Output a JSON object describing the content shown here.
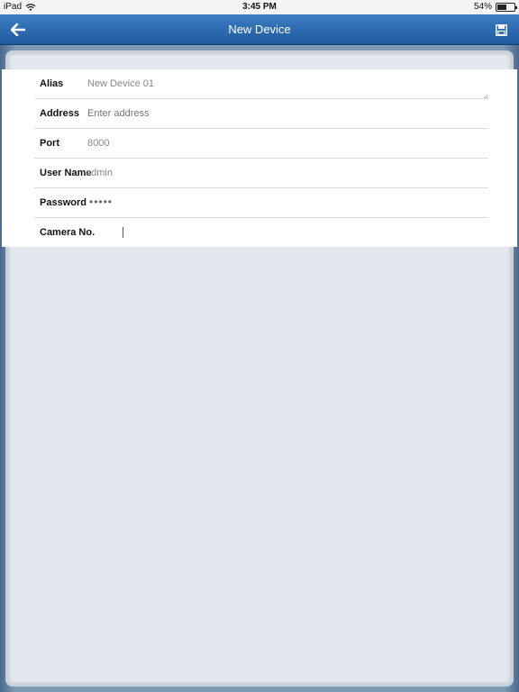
{
  "status_bar": {
    "device": "iPad",
    "time": "3:45 PM",
    "battery_text": "54%",
    "battery_level": 0.54
  },
  "nav": {
    "title": "New Device",
    "back_icon": "arrow-left-icon",
    "save_icon": "floppy-disk-icon"
  },
  "form": {
    "alias": {
      "label": "Alias",
      "value": "New Device 01"
    },
    "address": {
      "label": "Address",
      "placeholder": "Enter address"
    },
    "port": {
      "label": "Port",
      "value": "8000"
    },
    "username": {
      "label": "User Name",
      "value": "admin"
    },
    "password": {
      "label": "Password",
      "value": "•••••"
    },
    "camera": {
      "label": "Camera No."
    }
  },
  "colors": {
    "nav_top": "#3e7ec5",
    "nav_bottom": "#1f5a9e",
    "panel_bg": "#e4e9ef"
  }
}
